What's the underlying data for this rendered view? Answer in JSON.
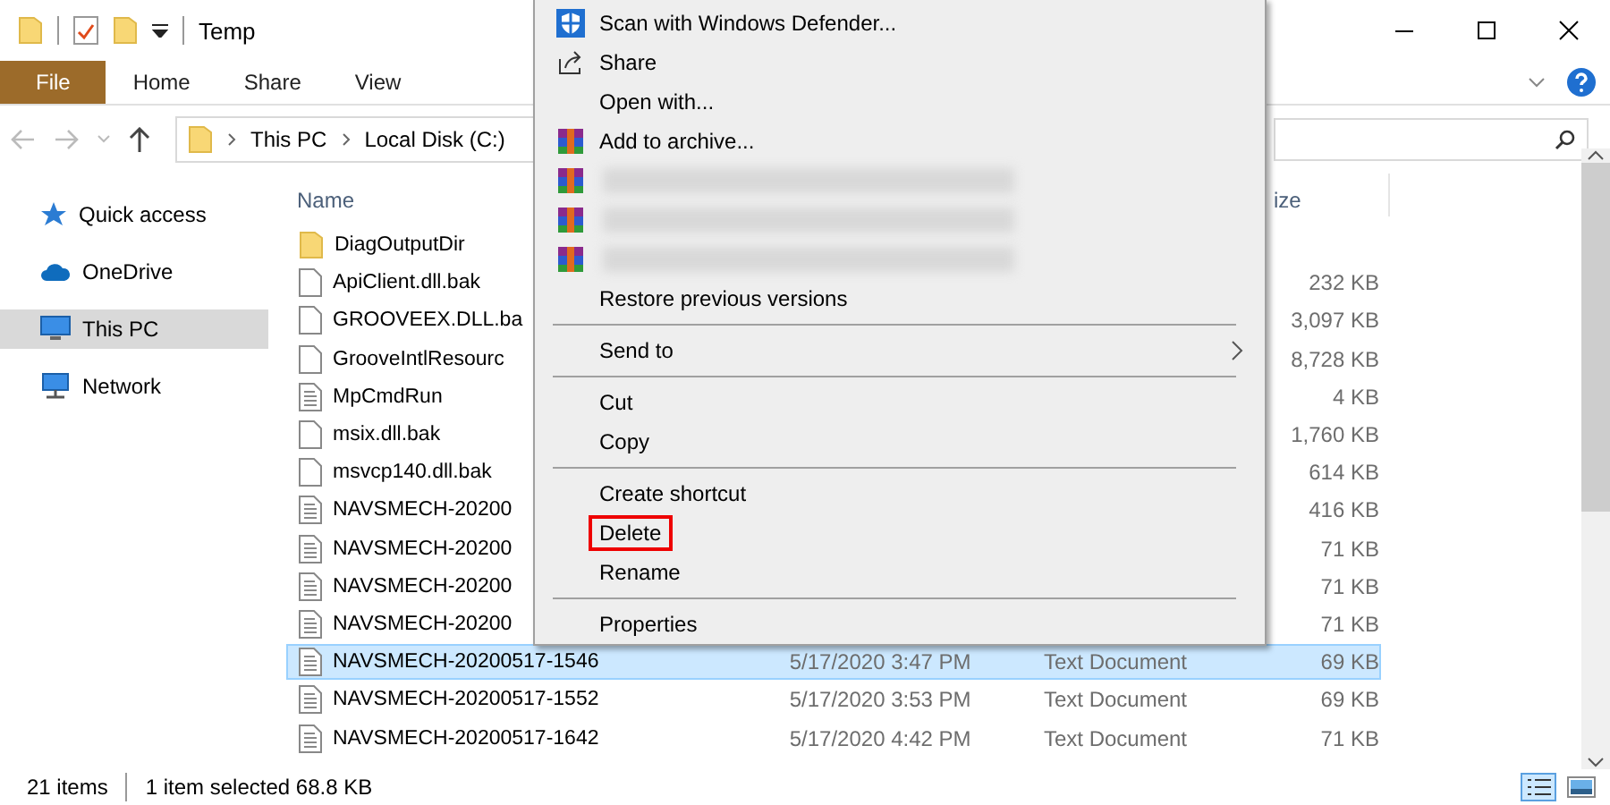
{
  "window": {
    "title": "Temp"
  },
  "ribbon": {
    "tabs": [
      {
        "label": "File",
        "selected": true
      },
      {
        "label": "Home",
        "selected": false
      },
      {
        "label": "Share",
        "selected": false
      },
      {
        "label": "View",
        "selected": false
      }
    ]
  },
  "address_bar": {
    "path": [
      "This PC",
      "Local Disk (C:)"
    ]
  },
  "sidebar": {
    "items": [
      {
        "label": "Quick access",
        "selected": false
      },
      {
        "label": "OneDrive",
        "selected": false
      },
      {
        "label": "This PC",
        "selected": true
      },
      {
        "label": "Network",
        "selected": false
      }
    ]
  },
  "file_list": {
    "columns": [
      "Name",
      "ize"
    ],
    "rows": [
      {
        "name": "DiagOutputDir",
        "kind": "folder",
        "selected": false
      },
      {
        "name": "ApiClient.dll.bak",
        "kind": "file",
        "size": "232 KB",
        "selected": false
      },
      {
        "name": "GROOVEEX.DLL.ba",
        "kind": "file",
        "size": "3,097 KB",
        "selected": false
      },
      {
        "name": "GrooveIntlResourc",
        "kind": "file",
        "size": "8,728 KB",
        "selected": false
      },
      {
        "name": "MpCmdRun",
        "kind": "text",
        "size": "4 KB",
        "selected": false
      },
      {
        "name": "msix.dll.bak",
        "kind": "file",
        "size": "1,760 KB",
        "selected": false
      },
      {
        "name": "msvcp140.dll.bak",
        "kind": "file",
        "size": "614 KB",
        "selected": false
      },
      {
        "name": "NAVSMECH-20200",
        "kind": "text",
        "size": "416 KB",
        "selected": false
      },
      {
        "name": "NAVSMECH-20200",
        "kind": "text",
        "size": "71 KB",
        "selected": false
      },
      {
        "name": "NAVSMECH-20200",
        "kind": "text",
        "size": "71 KB",
        "selected": false
      },
      {
        "name": "NAVSMECH-20200",
        "kind": "text",
        "size": "71 KB",
        "selected": false
      },
      {
        "name": "NAVSMECH-20200517-1546",
        "kind": "text",
        "date": "5/17/2020 3:47 PM",
        "type": "Text Document",
        "size": "69 KB",
        "selected": true
      },
      {
        "name": "NAVSMECH-20200517-1552",
        "kind": "text",
        "date": "5/17/2020 3:53 PM",
        "type": "Text Document",
        "size": "69 KB",
        "selected": false
      },
      {
        "name": "NAVSMECH-20200517-1642",
        "kind": "text",
        "date": "5/17/2020 4:42 PM",
        "type": "Text Document",
        "size": "71 KB",
        "selected": false
      }
    ]
  },
  "status_bar": {
    "item_count": "21 items",
    "selection": "1 item selected 68.8 KB"
  },
  "context_menu": {
    "items": [
      {
        "kind": "item",
        "label": "Scan with Windows Defender...",
        "highlighted": false
      },
      {
        "kind": "item",
        "label": "Share",
        "highlighted": false
      },
      {
        "kind": "item",
        "label": "Open with...",
        "highlighted": false
      },
      {
        "kind": "item",
        "label": "Add to archive...",
        "highlighted": false
      },
      {
        "kind": "blurred"
      },
      {
        "kind": "blurred"
      },
      {
        "kind": "blurred"
      },
      {
        "kind": "item",
        "label": "Restore previous versions",
        "highlighted": false
      },
      {
        "kind": "separator"
      },
      {
        "kind": "submenu",
        "label": "Send to",
        "highlighted": false
      },
      {
        "kind": "separator"
      },
      {
        "kind": "item",
        "label": "Cut",
        "highlighted": false
      },
      {
        "kind": "item",
        "label": "Copy",
        "highlighted": false
      },
      {
        "kind": "separator"
      },
      {
        "kind": "item",
        "label": "Create shortcut",
        "highlighted": false
      },
      {
        "kind": "item",
        "label": "Delete",
        "highlighted": true
      },
      {
        "kind": "item",
        "label": "Rename",
        "highlighted": false
      },
      {
        "kind": "separator"
      },
      {
        "kind": "item",
        "label": "Properties",
        "highlighted": false
      }
    ]
  }
}
